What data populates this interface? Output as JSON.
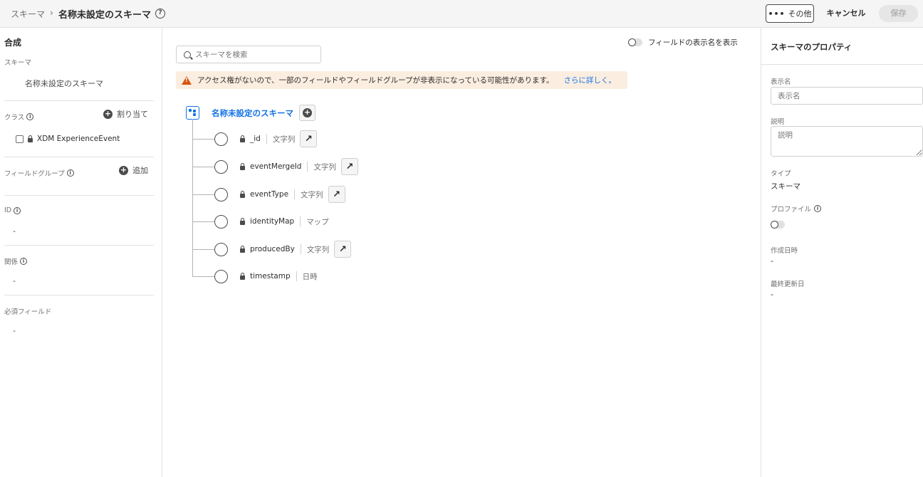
{
  "header": {
    "breadcrumb_root": "スキーマ",
    "breadcrumb_sep": "›",
    "title": "名称未設定のスキーマ",
    "help_icon": "?",
    "more_label": "その他",
    "more_dots": "•••",
    "cancel_label": "キャンセル",
    "save_label": "保存"
  },
  "left": {
    "title": "合成",
    "schema_label": "スキーマ",
    "schema_value": "名称未設定のスキーマ",
    "class_label": "クラス",
    "assign_label": "割り当て",
    "class_item": "XDM ExperienceEvent",
    "fieldgroup_label": "フィールドグループ",
    "add_label": "追加",
    "id_label": "ID",
    "id_value": "-",
    "relation_label": "関係",
    "relation_value": "-",
    "required_label": "必須フィールド",
    "required_value": "-",
    "info_icon": "i",
    "plus_icon": "+"
  },
  "center": {
    "search_placeholder": "スキーマを検索",
    "toggle_label": "フィールドの表示名を表示",
    "alert_text": "アクセス権がないので、一部のフィールドやフィールドグループが非表示になっている可能性があります。",
    "alert_link": "さらに詳しく。",
    "root_label": "名称未設定のスキーマ",
    "jump_icon": "↗",
    "fields": [
      {
        "name": "_id",
        "type": "文字列",
        "has_jump": true
      },
      {
        "name": "eventMergeId",
        "type": "文字列",
        "has_jump": true
      },
      {
        "name": "eventType",
        "type": "文字列",
        "has_jump": true
      },
      {
        "name": "identityMap",
        "type": "マップ",
        "has_jump": false
      },
      {
        "name": "producedBy",
        "type": "文字列",
        "has_jump": true
      },
      {
        "name": "timestamp",
        "type": "日時",
        "has_jump": false
      }
    ]
  },
  "right": {
    "title": "スキーマのプロパティ",
    "display_name_label": "表示名",
    "display_name_placeholder": "表示名",
    "description_label": "説明",
    "description_placeholder": "説明",
    "type_label": "タイプ",
    "type_value": "スキーマ",
    "profile_label": "プロファイル",
    "created_label": "作成日時",
    "created_value": "-",
    "updated_label": "最終更新日",
    "updated_value": "-"
  },
  "colors": {
    "accent": "#1473e6",
    "warning": "#d7560f",
    "alert_bg": "#fbeee0"
  }
}
